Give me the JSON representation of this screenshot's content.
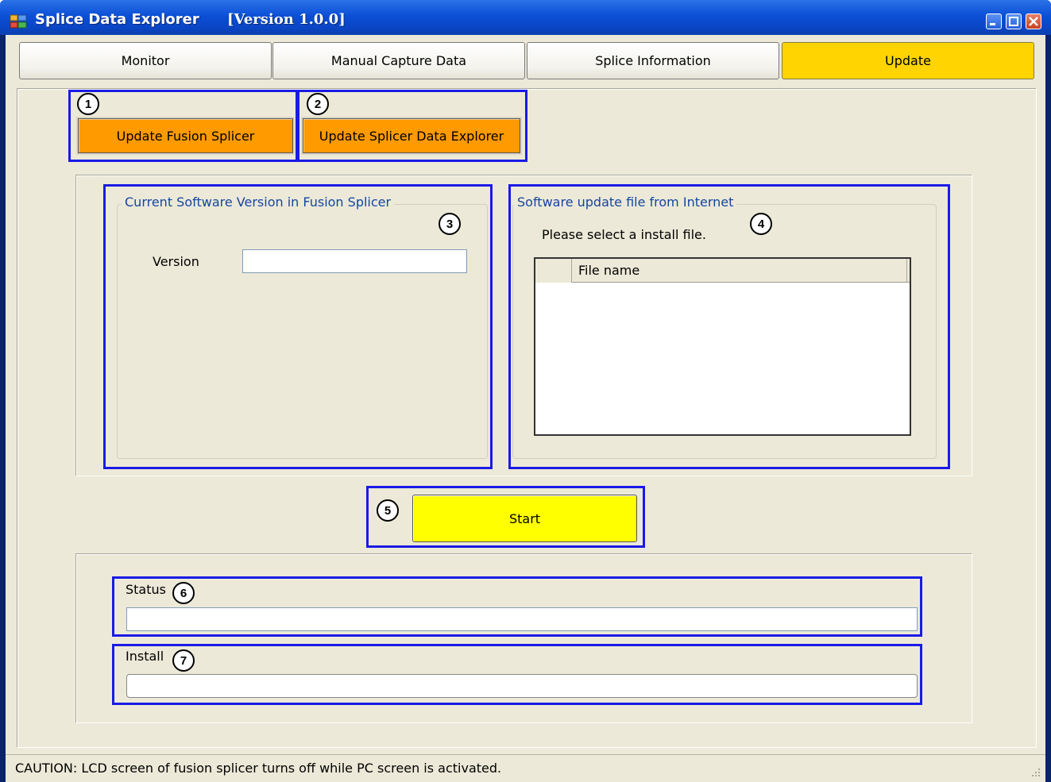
{
  "window": {
    "title": "Splice Data Explorer",
    "version": "[Version 1.0.0]",
    "controls": [
      "minimize",
      "maximize",
      "close"
    ]
  },
  "tabs": [
    {
      "label": "Monitor",
      "active": false
    },
    {
      "label": "Manual Capture Data",
      "active": false
    },
    {
      "label": "Splice Information",
      "active": false
    },
    {
      "label": "Update",
      "active": true
    }
  ],
  "update_buttons": {
    "fusion_splicer": "Update Fusion Splicer",
    "data_explorer": "Update Splicer Data Explorer"
  },
  "callouts": [
    "1",
    "2",
    "3",
    "4",
    "5",
    "6",
    "7"
  ],
  "current_version_group": {
    "title": "Current Software Version in Fusion Splicer",
    "version_label": "Version",
    "version_value": ""
  },
  "internet_group": {
    "title": "Software update file from Internet",
    "instruction": "Please select a install file.",
    "grid_header": "File name",
    "files": []
  },
  "start_label": "Start",
  "progress": {
    "status_label": "Status",
    "install_label": "Install",
    "status_value": "",
    "install_value": ""
  },
  "status_bar": "CAUTION: LCD screen of fusion splicer turns off while PC screen is activated.",
  "colors": {
    "active_tab": "#ffd400",
    "update_button": "#ff9a00",
    "start_button": "#ffff00",
    "callout_border": "#1a1ae6",
    "group_title": "#1546a0"
  }
}
